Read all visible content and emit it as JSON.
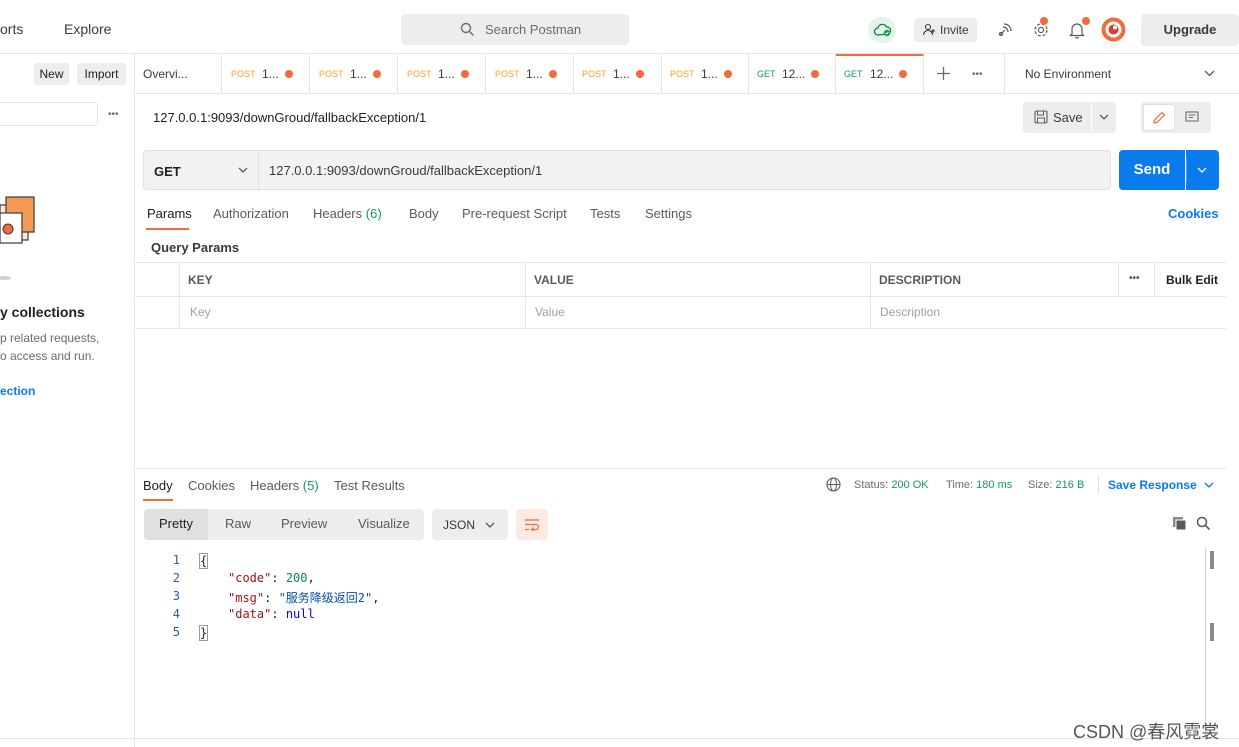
{
  "header": {
    "nav": [
      "orts",
      "Explore"
    ],
    "search_placeholder": "Search Postman",
    "invite_label": "Invite",
    "upgrade_label": "Upgrade"
  },
  "sidebar": {
    "new_label": "New",
    "import_label": "Import",
    "more_label": "•••",
    "empty_title": "y collections",
    "empty_text_1": "p related requests,",
    "empty_text_2": "o access and run.",
    "create_link": "ection"
  },
  "tabs": [
    {
      "method": "",
      "name": "Overvi..."
    },
    {
      "method": "POST",
      "name": "1..."
    },
    {
      "method": "POST",
      "name": "1..."
    },
    {
      "method": "POST",
      "name": "1..."
    },
    {
      "method": "POST",
      "name": "1..."
    },
    {
      "method": "POST",
      "name": "1..."
    },
    {
      "method": "POST",
      "name": "1..."
    },
    {
      "method": "GET",
      "name": "12..."
    },
    {
      "method": "GET",
      "name": "12..."
    }
  ],
  "tab_more": "•••",
  "environment": "No Environment",
  "request": {
    "title": "127.0.0.1:9093/downGroud/fallbackException/1",
    "save_label": "Save",
    "method": "GET",
    "url": "127.0.0.1:9093/downGroud/fallbackException/1",
    "send_label": "Send",
    "tabs": {
      "params": "Params",
      "authorization": "Authorization",
      "headers": "Headers",
      "headers_count": "(6)",
      "body": "Body",
      "prerequest": "Pre-request Script",
      "tests": "Tests",
      "settings": "Settings"
    },
    "cookies_label": "Cookies",
    "query_params_label": "Query Params",
    "table": {
      "key_header": "KEY",
      "value_header": "VALUE",
      "description_header": "DESCRIPTION",
      "more": "•••",
      "bulk_edit": "Bulk Edit",
      "key_placeholder": "Key",
      "value_placeholder": "Value",
      "description_placeholder": "Description"
    }
  },
  "response": {
    "tabs": {
      "body": "Body",
      "cookies": "Cookies",
      "headers": "Headers",
      "headers_count": "(5)",
      "test_results": "Test Results"
    },
    "status_label": "Status:",
    "status_value": "200 OK",
    "time_label": "Time:",
    "time_value": "180 ms",
    "size_label": "Size:",
    "size_value": "216 B",
    "save_response": "Save Response",
    "formats": [
      "Pretty",
      "Raw",
      "Preview",
      "Visualize"
    ],
    "language": "JSON",
    "lines": [
      "1",
      "2",
      "3",
      "4",
      "5"
    ],
    "code": {
      "open_brace": "{",
      "k_code": "\"code\"",
      "v_code": "200",
      "k_msg": "\"msg\"",
      "v_msg": "\"服务降级返回2\"",
      "k_data": "\"data\"",
      "v_data": "null",
      "close_brace": "}"
    }
  },
  "watermark": "CSDN @春风霓裳",
  "colors": {
    "accent": "#f26b3a",
    "primary": "#097bed",
    "success": "#0f9d58"
  }
}
